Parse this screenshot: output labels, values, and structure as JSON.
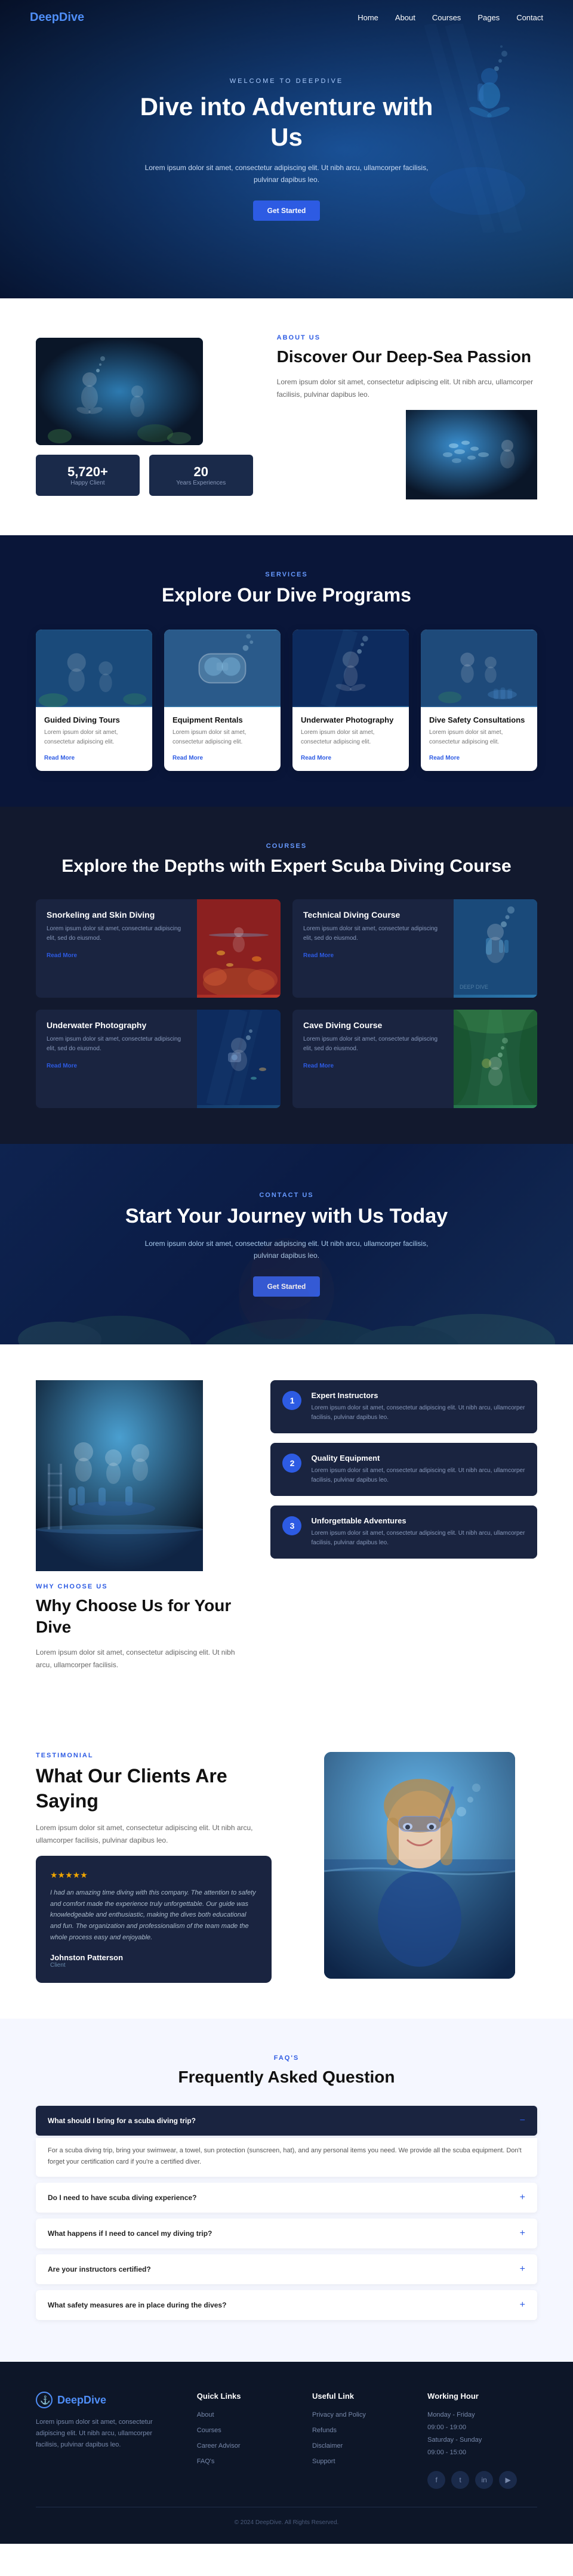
{
  "brand": {
    "name_part1": "Deep",
    "name_part2": "Dive",
    "logo_icon": "anchor-icon"
  },
  "nav": {
    "links": [
      {
        "label": "Home",
        "href": "#"
      },
      {
        "label": "About",
        "href": "#"
      },
      {
        "label": "Courses",
        "href": "#"
      },
      {
        "label": "Pages",
        "href": "#"
      },
      {
        "label": "Contact",
        "href": "#"
      }
    ]
  },
  "hero": {
    "welcome": "Welcome to DeepDive",
    "title": "Dive into Adventure with Us",
    "description": "Lorem ipsum dolor sit amet, consectetur adipiscing elit. Ut nibh arcu, ullamcorper facilisis, pulvinar dapibus leo.",
    "cta_label": "Get Started"
  },
  "about": {
    "label": "About Us",
    "title": "Discover Our Deep-Sea Passion",
    "description": "Lorem ipsum dolor sit amet, consectetur adipiscing elit. Ut nibh arcu, ullamcorper facilisis, pulvinar dapibus leo.",
    "stats": [
      {
        "value": "5,720+",
        "label": "Happy Client"
      },
      {
        "value": "20",
        "label": "Years Experiences"
      }
    ]
  },
  "services": {
    "label": "Services",
    "title": "Explore Our Dive Programs",
    "items": [
      {
        "title": "Guided Diving Tours",
        "description": "Lorem ipsum dolor sit amet, consectetur adipiscing elit.",
        "read_more": "Read More"
      },
      {
        "title": "Equipment Rentals",
        "description": "Lorem ipsum dolor sit amet, consectetur adipiscing elit.",
        "read_more": "Read More"
      },
      {
        "title": "Underwater Photography",
        "description": "Lorem ipsum dolor sit amet, consectetur adipiscing elit.",
        "read_more": "Read More"
      },
      {
        "title": "Dive Safety Consultations",
        "description": "Lorem ipsum dolor sit amet, consectetur adipiscing elit.",
        "read_more": "Read More"
      }
    ]
  },
  "courses": {
    "label": "Courses",
    "title": "Explore the Depths with Expert Scuba Diving Course",
    "items": [
      {
        "title": "Snorkeling and Skin Diving",
        "description": "Lorem ipsum dolor sit amet, consectetur adipiscing elit, sed do eiusmod.",
        "read_more": "Read More"
      },
      {
        "title": "Technical Diving Course",
        "description": "Lorem ipsum dolor sit amet, consectetur adipiscing elit, sed do eiusmod.",
        "read_more": "Read More"
      },
      {
        "title": "Underwater Photography",
        "description": "Lorem ipsum dolor sit amet, consectetur adipiscing elit, sed do eiusmod.",
        "read_more": "Read More"
      },
      {
        "title": "Cave Diving Course",
        "description": "Lorem ipsum dolor sit amet, consectetur adipiscing elit, sed do eiusmod.",
        "read_more": "Read More"
      }
    ]
  },
  "cta": {
    "label": "Contact Us",
    "title": "Start Your Journey with Us Today",
    "description": "Lorem ipsum dolor sit amet, consectetur adipiscing elit. Ut nibh arcu, ullamcorper facilisis, pulvinar dapibus leo.",
    "cta_label": "Get Started"
  },
  "why": {
    "label": "Why Choose Us",
    "title": "Why Choose Us for Your Dive",
    "description": "Lorem ipsum dolor sit amet, consectetur adipiscing elit. Ut nibh arcu, ullamcorper facilisis.",
    "reasons": [
      {
        "num": "1",
        "title": "Expert Instructors",
        "description": "Lorem ipsum dolor sit amet, consectetur adipiscing elit. Ut nibh arcu, ullamcorper facilisis, pulvinar dapibus leo."
      },
      {
        "num": "2",
        "title": "Quality Equipment",
        "description": "Lorem ipsum dolor sit amet, consectetur adipiscing elit. Ut nibh arcu, ullamcorper facilisis, pulvinar dapibus leo."
      },
      {
        "num": "3",
        "title": "Unforgettable Adventures",
        "description": "Lorem ipsum dolor sit amet, consectetur adipiscing elit. Ut nibh arcu, ullamcorper facilisis, pulvinar dapibus leo."
      }
    ]
  },
  "testimonial": {
    "label": "Testimonial",
    "title": "What Our Clients Are Saying",
    "description": "Lorem ipsum dolor sit amet, consectetur adipiscing elit. Ut nibh arcu, ullamcorper facilisis, pulvinar dapibus leo.",
    "card": {
      "text": "I had an amazing time diving with this company. The attention to safety and comfort made the experience truly unforgettable. Our guide was knowledgeable and enthusiastic, making the dives both educational and fun. The organization and professionalism of the team made the whole process easy and enjoyable.",
      "author": "Johnston Patterson",
      "role": "Client",
      "stars": "★★★★★"
    }
  },
  "faq": {
    "label": "FAQ's",
    "title": "Frequently Asked Question",
    "items": [
      {
        "question": "What should I bring for a scuba diving trip?",
        "answer": "For a scuba diving trip, bring your swimwear, a towel, sun protection (sunscreen, hat), and any personal items you need. We provide all the scuba equipment. Don't forget your certification card if you're a certified diver.",
        "open": true
      },
      {
        "question": "Do I need to have scuba diving experience?",
        "answer": "",
        "open": false
      },
      {
        "question": "What happens if I need to cancel my diving trip?",
        "answer": "",
        "open": false
      },
      {
        "question": "Are your instructors certified?",
        "answer": "",
        "open": false
      },
      {
        "question": "What safety measures are in place during the dives?",
        "answer": "",
        "open": false
      }
    ]
  },
  "footer": {
    "brand": "DeepDive",
    "description": "Lorem ipsum dolor sit amet, consectetur adipiscing elit. Ut nibh arcu, ullamcorper facilisis, pulvinar dapibus leo.",
    "quick_links": {
      "title": "Quick Links",
      "items": [
        {
          "label": "About",
          "href": "#"
        },
        {
          "label": "Courses",
          "href": "#"
        },
        {
          "label": "Career Advisor",
          "href": "#"
        },
        {
          "label": "FAQ's",
          "href": "#"
        }
      ]
    },
    "useful_links": {
      "title": "Useful Link",
      "items": [
        {
          "label": "Privacy and Policy",
          "href": "#"
        },
        {
          "label": "Refunds",
          "href": "#"
        },
        {
          "label": "Disclaimer",
          "href": "#"
        },
        {
          "label": "Support",
          "href": "#"
        }
      ]
    },
    "working_hours": {
      "title": "Working Hour",
      "lines": [
        "Monday - Friday",
        "09:00 - 19:00",
        "Saturday - Sunday",
        "09:00 - 15:00"
      ]
    },
    "social": [
      "f",
      "t",
      "in",
      "yt"
    ],
    "copyright": "© 2024 DeepDive. All Rights Reserved."
  }
}
